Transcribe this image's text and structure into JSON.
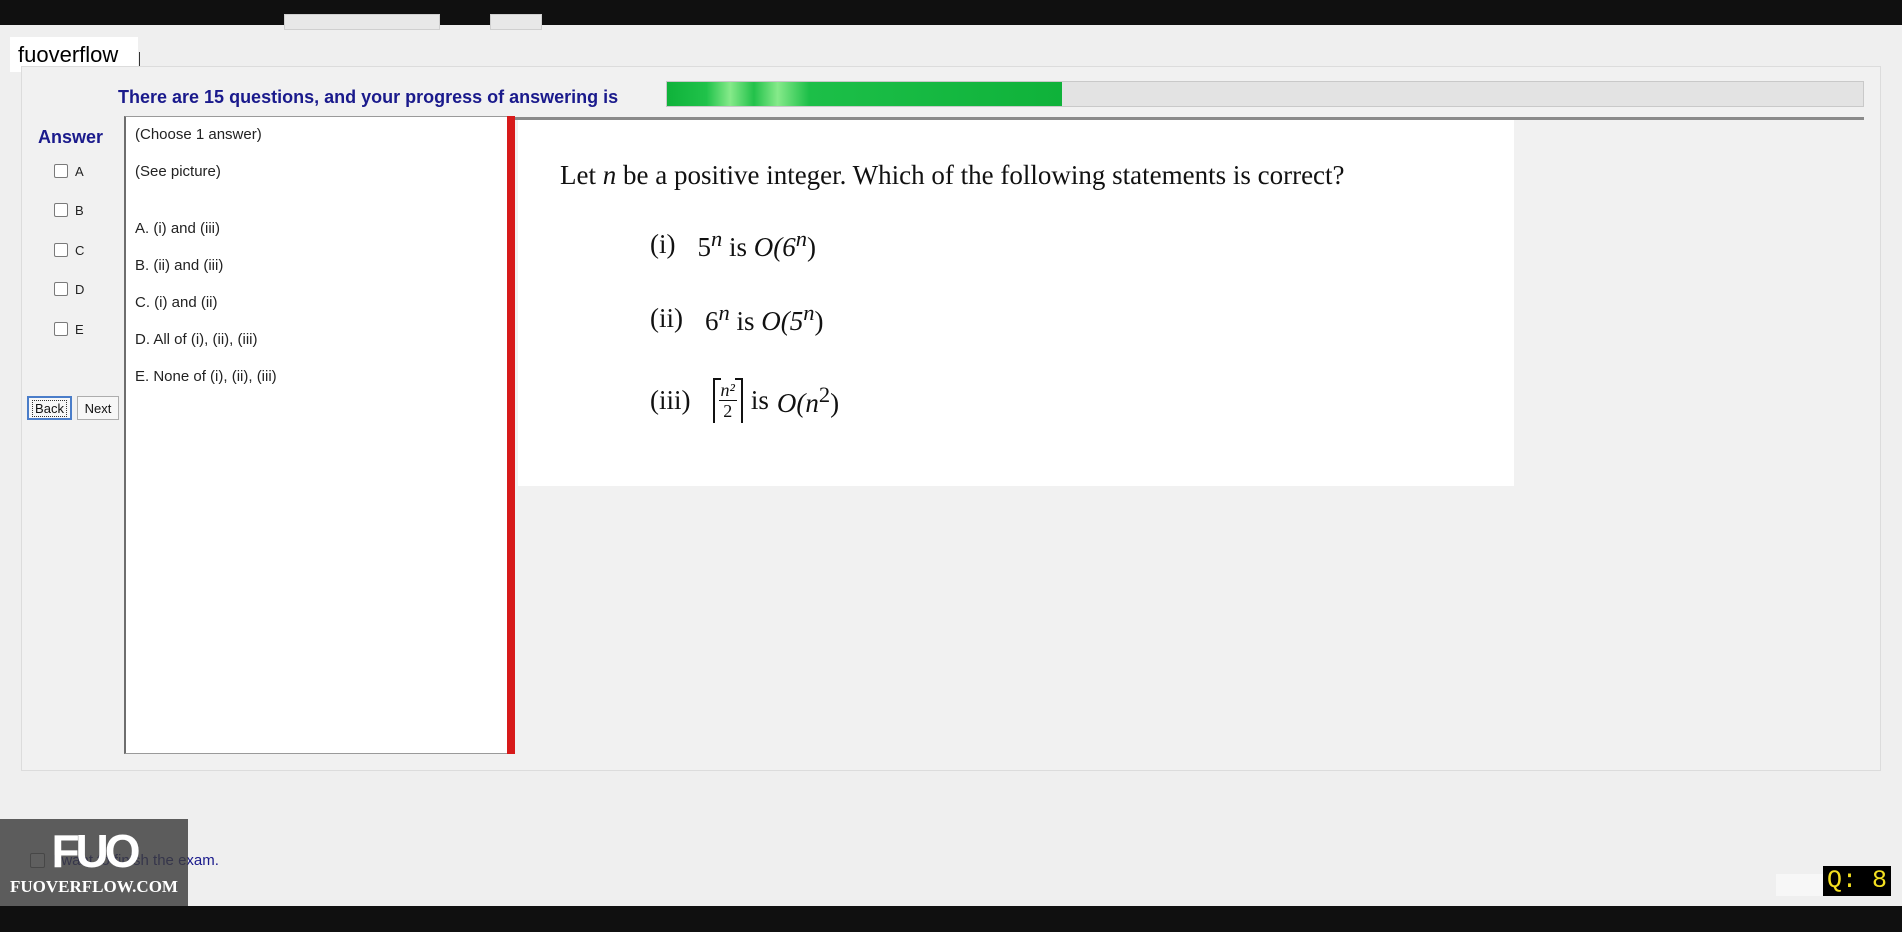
{
  "user": {
    "name": "fuoverflow"
  },
  "progress": {
    "label": "There are 15 questions, and your progress of answering is",
    "fraction": 0.33,
    "fill_color": "#0fb23a"
  },
  "answer_panel": {
    "title": "Answer",
    "choices": [
      "A",
      "B",
      "C",
      "D",
      "E"
    ],
    "back_label": "Back",
    "next_label": "Next"
  },
  "answers_text": {
    "instruction": "(Choose 1 answer)",
    "hint": "(See picture)",
    "options": [
      "A.  (i) and (iii)",
      "B.  (ii) and (iii)",
      "C.  (i) and (ii)",
      "D.  All of (i), (ii), (iii)",
      "E.  None of (i), (ii), (iii)"
    ]
  },
  "question": {
    "stem_pre": "Let ",
    "stem_var": "n",
    "stem_post": " be a positive integer. Which of the following statements is correct?",
    "items": [
      {
        "label": "(i)",
        "lhs_base": "5",
        "lhs_exp": "n",
        "mid": "is",
        "rhs": "O(6",
        "rhs_exp": "n",
        "rhs_close": ")"
      },
      {
        "label": "(ii)",
        "lhs_base": "6",
        "lhs_exp": "n",
        "mid": "is",
        "rhs": "O(5",
        "rhs_exp": "n",
        "rhs_close": ")"
      },
      {
        "label": "(iii)",
        "frac_num": "n²",
        "frac_den": "2",
        "mid": "is",
        "rhs": "O(n",
        "rhs_exp": "2",
        "rhs_close": ")"
      }
    ]
  },
  "finish": {
    "label": "I want to finish the exam."
  },
  "branding": {
    "logo_mark": "FUO",
    "logo_text": "FUOVERFLOW.COM"
  },
  "question_counter": "Q: 8",
  "colors": {
    "accent": "#1a1a8c",
    "divider": "#d71a1a",
    "badge_text": "#f4e020"
  }
}
